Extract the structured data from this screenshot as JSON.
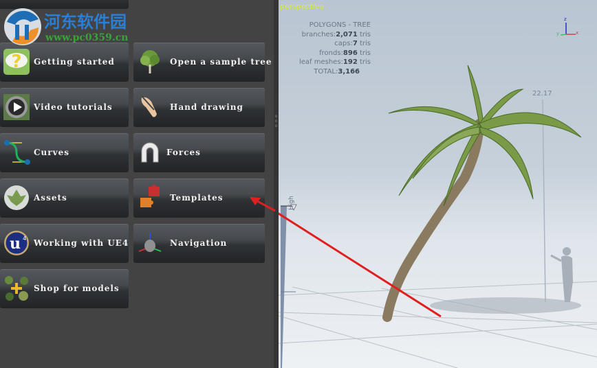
{
  "watermark": {
    "title": "河东软件园",
    "url": "www.pc0359.cn"
  },
  "buttons": [
    {
      "label": "Getting started",
      "icon": "question-cloud-icon"
    },
    {
      "label": "Open a sample tree",
      "icon": "tree-icon"
    },
    {
      "label": "Video tutorials",
      "icon": "play-icon"
    },
    {
      "label": "Hand drawing",
      "icon": "hand-pen-icon"
    },
    {
      "label": "Curves",
      "icon": "curve-icon"
    },
    {
      "label": "Forces",
      "icon": "magnet-icon"
    },
    {
      "label": "Assets",
      "icon": "leaf-sphere-icon"
    },
    {
      "label": "Templates",
      "icon": "puzzle-icon"
    },
    {
      "label": "Working with UE4",
      "icon": "ue4-logo-icon"
    },
    {
      "label": "Navigation",
      "icon": "axis-gizmo-icon"
    },
    {
      "label": "Shop for models",
      "icon": "shop-plants-icon"
    }
  ],
  "viewport": {
    "camera_label": "perspective",
    "stats_title": "POLYGONS - TREE",
    "stats": [
      {
        "key": "branches:",
        "value": "2,071",
        "unit": " tris"
      },
      {
        "key": "caps:",
        "value": "7",
        "unit": " tris"
      },
      {
        "key": "fronds:",
        "value": "896",
        "unit": " tris"
      },
      {
        "key": "leaf meshes:",
        "value": "192",
        "unit": " tris"
      },
      {
        "key": "TOTAL:",
        "value": "3,166",
        "unit": ""
      }
    ],
    "height_marker": "22.17",
    "lod_label": "High",
    "axis": {
      "z": "z",
      "x": "x",
      "y": "y"
    }
  },
  "colors": {
    "accent_arrow": "#e02020",
    "camera_label": "#d8e84a"
  }
}
